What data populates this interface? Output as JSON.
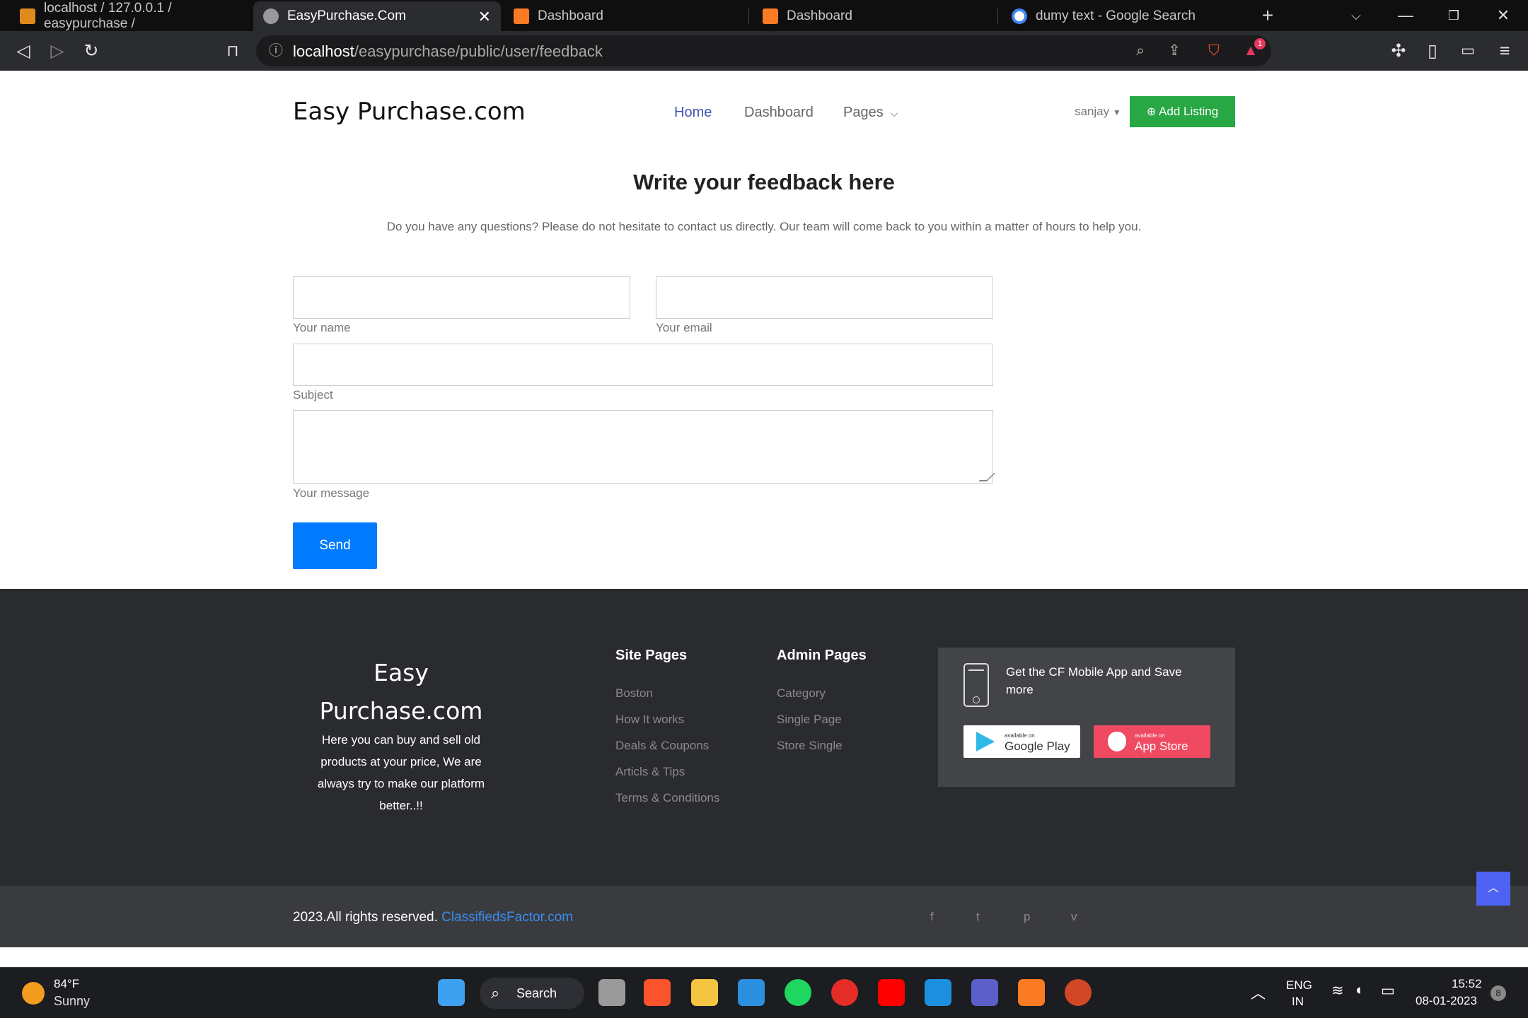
{
  "browser": {
    "tabs": [
      {
        "label": "localhost / 127.0.0.1 / easypurchase /",
        "icon": "phpmyadmin-icon"
      },
      {
        "label": "EasyPurchase.Com",
        "icon": "globe-icon",
        "active": true
      },
      {
        "label": "Dashboard",
        "icon": "xampp-icon"
      },
      {
        "label": "Dashboard",
        "icon": "xampp-icon"
      },
      {
        "label": "dumy text - Google Search",
        "icon": "google-icon"
      }
    ],
    "url_host": "localhost",
    "url_path": "/easypurchase/public/user/feedback",
    "extension_badge": "1"
  },
  "header": {
    "brand": "Easy Purchase.com",
    "nav": [
      "Home",
      "Dashboard",
      "Pages"
    ],
    "user": "sanjay",
    "add_listing": "Add Listing"
  },
  "feedback": {
    "title": "Write your feedback here",
    "subtitle": "Do you have any questions? Please do not hesitate to contact us directly. Our team will come back to you within a matter of hours to help you.",
    "labels": {
      "name": "Your name",
      "email": "Your email",
      "subject": "Subject",
      "message": "Your message"
    },
    "values": {
      "name": "",
      "email": "",
      "subject": "",
      "message": ""
    },
    "send": "Send"
  },
  "footer": {
    "brand": "Easy Purchase.com",
    "description": "Here you can buy and sell old products at your price, We are always try to make our platform better..!!",
    "site_pages_title": "Site Pages",
    "site_pages": [
      "Boston",
      "How It works",
      "Deals & Coupons",
      "Articls & Tips",
      "Terms & Conditions"
    ],
    "admin_pages_title": "Admin Pages",
    "admin_pages": [
      "Category",
      "Single Page",
      "Store Single"
    ],
    "app_text": "Get the CF Mobile App and Save more",
    "google_small": "available on",
    "google_big": "Google Play",
    "apple_small": "available on",
    "apple_big": "App Store",
    "copyright": "2023.All rights reserved.",
    "copyright_link": "ClassifiedsFactor.com",
    "social": [
      "f",
      "t",
      "p",
      "v"
    ]
  },
  "taskbar": {
    "temperature": "84°F",
    "condition": "Sunny",
    "search": "Search",
    "lang1": "ENG",
    "lang2": "IN",
    "time": "15:52",
    "date": "08-01-2023",
    "notifications": "8"
  },
  "colors": {
    "accent": "#3f51b5",
    "success": "#28a745",
    "primary": "#007bff",
    "footer": "#2a2b2f"
  }
}
